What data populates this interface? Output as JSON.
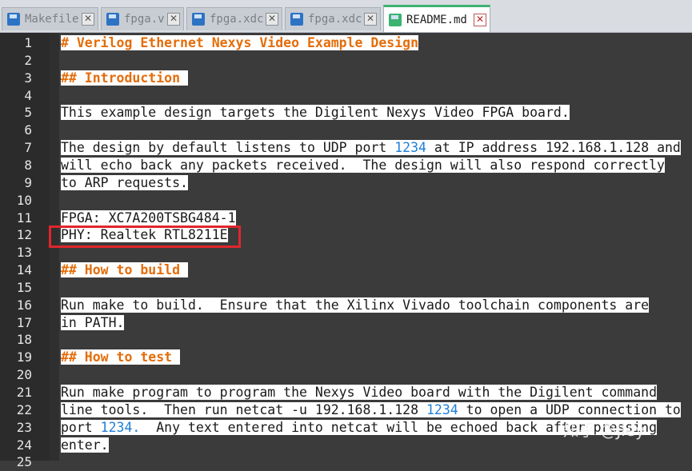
{
  "tabs": [
    {
      "label": "Makefile",
      "active": false
    },
    {
      "label": "fpga.v",
      "active": false
    },
    {
      "label": "fpga.xdc",
      "active": false
    },
    {
      "label": "fpga.xdc",
      "active": false
    },
    {
      "label": "README.md",
      "active": true
    }
  ],
  "lines": [
    {
      "n": "1",
      "segs": [
        {
          "t": "# Verilog Ethernet Nexys Video Example Design",
          "c": "h"
        }
      ]
    },
    {
      "n": "2",
      "segs": []
    },
    {
      "n": "3",
      "segs": [
        {
          "t": "## Introduction ",
          "c": "h"
        }
      ]
    },
    {
      "n": "4",
      "segs": []
    },
    {
      "n": "5",
      "segs": [
        {
          "t": "This example design targets the Digilent Nexys Video FPGA board.",
          "c": "w"
        }
      ]
    },
    {
      "n": "6",
      "segs": []
    },
    {
      "n": "7",
      "segs": [
        {
          "t": "The design by default listens to UDP port ",
          "c": "w"
        },
        {
          "t": "1234",
          "c": "num"
        },
        {
          "t": " at IP address 192.168.1.128 and",
          "c": "w"
        }
      ]
    },
    {
      "n": "8",
      "segs": [
        {
          "t": "will echo back any packets received.  The design will also respond correctly",
          "c": "w"
        }
      ]
    },
    {
      "n": "9",
      "segs": [
        {
          "t": "to ARP requests.",
          "c": "w"
        }
      ]
    },
    {
      "n": "10",
      "segs": []
    },
    {
      "n": "11",
      "segs": [
        {
          "t": "FPGA: XC7A200TSBG484-1",
          "c": "w"
        }
      ]
    },
    {
      "n": "12",
      "segs": [
        {
          "t": "PHY: Realtek RTL8211E",
          "c": "w"
        }
      ]
    },
    {
      "n": "13",
      "segs": []
    },
    {
      "n": "14",
      "segs": [
        {
          "t": "## How to build ",
          "c": "h"
        }
      ]
    },
    {
      "n": "15",
      "segs": []
    },
    {
      "n": "16",
      "segs": [
        {
          "t": "Run make to build.  Ensure that the Xilinx Vivado toolchain components are",
          "c": "w"
        }
      ]
    },
    {
      "n": "17",
      "segs": [
        {
          "t": "in PATH.",
          "c": "w"
        }
      ]
    },
    {
      "n": "18",
      "segs": []
    },
    {
      "n": "19",
      "segs": [
        {
          "t": "## How to test ",
          "c": "h"
        }
      ]
    },
    {
      "n": "20",
      "segs": []
    },
    {
      "n": "21",
      "segs": [
        {
          "t": "Run make program to program the Nexys Video board with the Digilent command",
          "c": "w"
        }
      ]
    },
    {
      "n": "22",
      "segs": [
        {
          "t": "line tools.  Then run netcat -u 192.168.1.128 ",
          "c": "w"
        },
        {
          "t": "1234",
          "c": "num"
        },
        {
          "t": " to open a UDP connection to",
          "c": "w"
        }
      ]
    },
    {
      "n": "23",
      "segs": [
        {
          "t": "port ",
          "c": "w"
        },
        {
          "t": "1234.",
          "c": "num"
        },
        {
          "t": "  Any text entered into netcat will be echoed back after pressing",
          "c": "w"
        }
      ]
    },
    {
      "n": "24",
      "segs": [
        {
          "t": "enter.",
          "c": "w"
        }
      ]
    },
    {
      "n": "25",
      "segs": []
    }
  ],
  "watermark": "知乎 @Jiey"
}
